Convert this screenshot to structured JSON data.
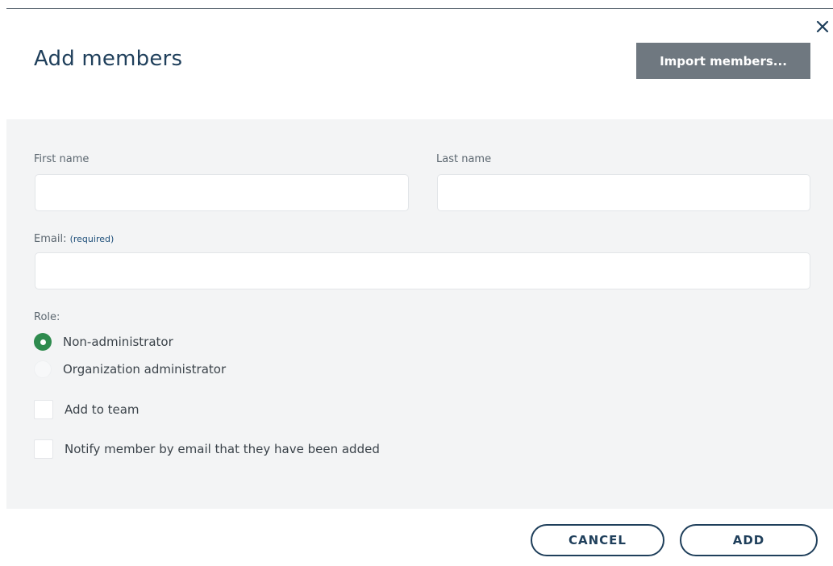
{
  "dialog": {
    "title": "Add members",
    "import_button": "Import members..."
  },
  "form": {
    "first_name": {
      "label": "First name",
      "value": "",
      "placeholder": ""
    },
    "last_name": {
      "label": "Last name",
      "value": "",
      "placeholder": ""
    },
    "email": {
      "label": "Email:",
      "required_hint": "(required)",
      "value": "",
      "placeholder": ""
    },
    "role": {
      "label": "Role:",
      "options": [
        {
          "label": "Non-administrator",
          "selected": true
        },
        {
          "label": "Organization administrator",
          "selected": false
        }
      ]
    },
    "add_to_team": {
      "label": "Add to team",
      "checked": false
    },
    "notify": {
      "label": "Notify member by email that they have been added",
      "checked": false
    }
  },
  "footer": {
    "cancel_label": "CANCEL",
    "add_label": "ADD"
  },
  "colors": {
    "title": "#1f3f5b",
    "import_button_bg": "#6f7880",
    "panel_bg": "#f3f4f5",
    "radio_selected": "#2e8b4e",
    "button_border": "#1f3f5b"
  },
  "icons": {
    "close": "close-icon"
  }
}
